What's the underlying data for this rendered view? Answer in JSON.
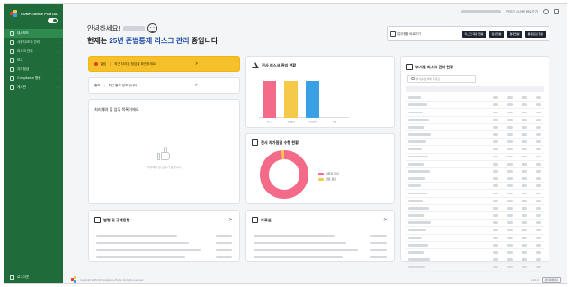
{
  "app": {
    "name": "COMPLIANCE PORTAL"
  },
  "sidebar": {
    "items": [
      {
        "label": "대시보드",
        "active": true,
        "chevron": ""
      },
      {
        "label": "사용자/조직 관리",
        "active": false,
        "chevron": "⌄"
      },
      {
        "label": "리스크 관리",
        "active": false,
        "chevron": "⌄"
      },
      {
        "label": "보고",
        "active": false,
        "chevron": ""
      },
      {
        "label": "자가점검",
        "active": false,
        "chevron": "⌄"
      },
      {
        "label": "Compliance 활동",
        "active": false,
        "chevron": "⌄"
      },
      {
        "label": "게시판",
        "active": false,
        "chevron": "⌄"
      }
    ],
    "logout_label": "로그아웃"
  },
  "topbar": {
    "link": "관리자 시스템 바로가기"
  },
  "greeting": {
    "hello": "안녕하세요!",
    "line2_prefix": "현재는",
    "line2_highlight": "25년 준법통제 리스크 관리",
    "line2_suffix": "중입니다"
  },
  "actions": {
    "external_label": "업무현황 바로가기",
    "buttons": [
      "리스크 대응 현황",
      "점검현황",
      "결재현황",
      "통제점검 현황"
    ]
  },
  "alerts": {
    "primary": {
      "tag": "알림",
      "text": "최근 처리된 점검을 확인하세요",
      "arrow": ">"
    },
    "secondary": {
      "tag": "통보",
      "text": "최근 통보 정보입니다",
      "arrow": ">"
    }
  },
  "tasks": {
    "title": "처리해야 할 업무 목록이에요",
    "empty_text": "처리해야 할 업무가 없습니다"
  },
  "risk_chart": {
    "title": "전사 리스크 관리 현황",
    "chart_data": {
      "type": "bar",
      "categories": [
        "리스크",
        "통제활동",
        "점검결과",
        "미흡"
      ],
      "values": [
        45,
        45,
        45,
        0
      ],
      "colors": [
        "#f46b8a",
        "#f7c94a",
        "#3aa0e6",
        "#dddddd"
      ],
      "ylim": [
        0,
        50
      ]
    }
  },
  "donut": {
    "title": "전사 자가점검 수행 현황",
    "chart_data": {
      "type": "pie",
      "labels": [
        "미완료 점검",
        "완료 점검"
      ],
      "values": [
        98,
        2
      ],
      "colors": [
        "#f46b8a",
        "#f7c94a"
      ]
    }
  },
  "dept": {
    "title": "부서별 리스크 관리 현황",
    "search_placeholder": "부서를 검색해 주세요",
    "row_count": 24
  },
  "notice": {
    "title": "법령 및 규제동향",
    "go": ">"
  },
  "archive": {
    "title": "자료실",
    "go": ">"
  },
  "footer": {
    "copyright": "Copyright 2025 All Compliance Portal. All rights reserved.",
    "version": "v1.0.0",
    "button": "관리자페이지"
  }
}
